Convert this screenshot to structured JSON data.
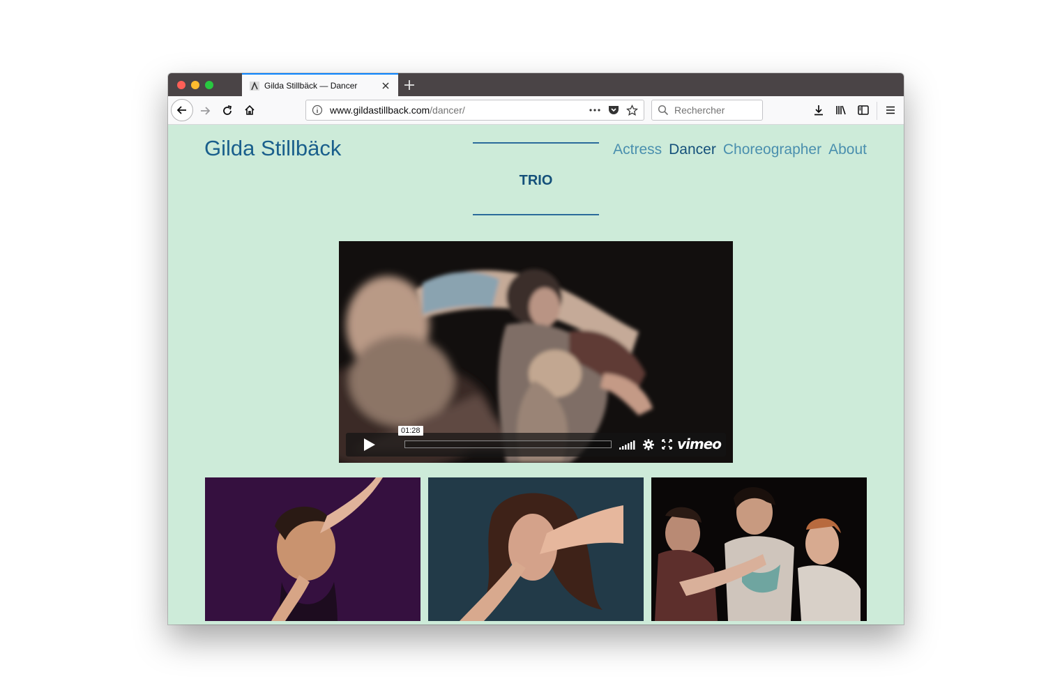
{
  "browser": {
    "tab": {
      "title": "Gilda Stillbäck — Dancer"
    },
    "url": {
      "host": "www.gildastillback.com",
      "path": "/dancer/"
    },
    "search": {
      "placeholder": "Rechercher"
    }
  },
  "site": {
    "title": "Gilda Stillbäck",
    "nav": [
      {
        "label": "Actress",
        "active": false
      },
      {
        "label": "Dancer",
        "active": true
      },
      {
        "label": "Choreographer",
        "active": false
      },
      {
        "label": "About",
        "active": false
      }
    ],
    "project": {
      "title": "TRIO"
    }
  },
  "video": {
    "time": "01:28",
    "brand": "vimeo",
    "progress": 0
  },
  "colors": {
    "page_bg": "#cdebd9",
    "title": "#1a5f8c",
    "nav_active": "#14507a",
    "nav_link": "#4a8fae",
    "thumb_1_bg": "#35103f",
    "thumb_2_bg": "#223a48",
    "thumb_3_bg": "#0a0707"
  },
  "icons": {
    "toolbar": [
      "back-icon",
      "forward-icon",
      "reload-icon",
      "home-icon",
      "info-icon",
      "more-icon",
      "pocket-icon",
      "star-icon",
      "search-icon",
      "download-icon",
      "library-icon",
      "sidebar-icon",
      "menu-icon"
    ],
    "player": [
      "play-icon",
      "volume-icon",
      "settings-icon",
      "fullscreen-icon"
    ]
  }
}
